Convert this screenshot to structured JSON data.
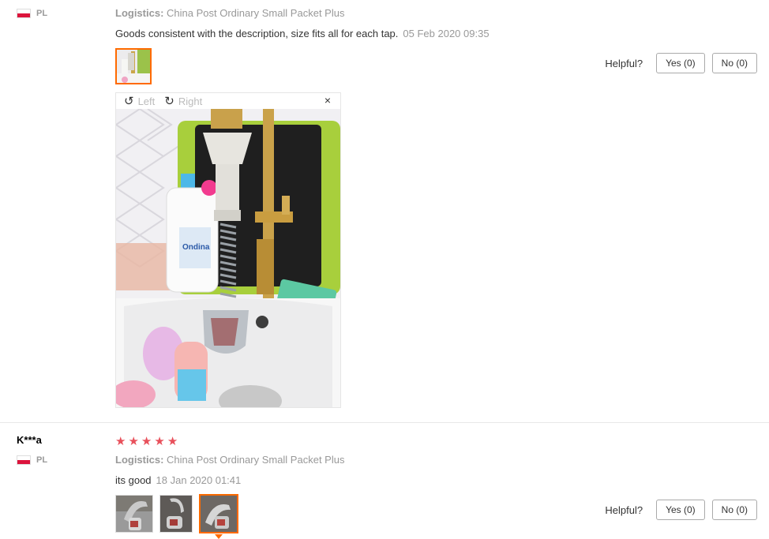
{
  "reviews": [
    {
      "country": "PL",
      "logistics_label": "Logistics:",
      "logistics_value": "China Post Ordinary Small Packet Plus",
      "text": "Goods consistent with the description, size fits all for each tap.",
      "date": "05 Feb 2020 09:35",
      "helpful_label": "Helpful?",
      "yes_label": "Yes (0)",
      "no_label": "No (0)",
      "viewer": {
        "left_label": "Left",
        "right_label": "Right",
        "close": "×"
      }
    },
    {
      "username": "K***a",
      "rating": 5,
      "country": "PL",
      "logistics_label": "Logistics:",
      "logistics_value": "China Post Ordinary Small Packet Plus",
      "text": "its good",
      "date": "18 Jan 2020 01:41",
      "helpful_label": "Helpful?",
      "yes_label": "Yes (0)",
      "no_label": "No (0)"
    }
  ],
  "icons": {
    "rotate_left": "rotate-left-icon",
    "rotate_right": "rotate-right-icon",
    "close": "close-icon",
    "star": "star-icon",
    "flag": "poland-flag-icon"
  },
  "colors": {
    "accent": "#ff6a00",
    "star": "#e8505b",
    "muted": "#999999"
  }
}
